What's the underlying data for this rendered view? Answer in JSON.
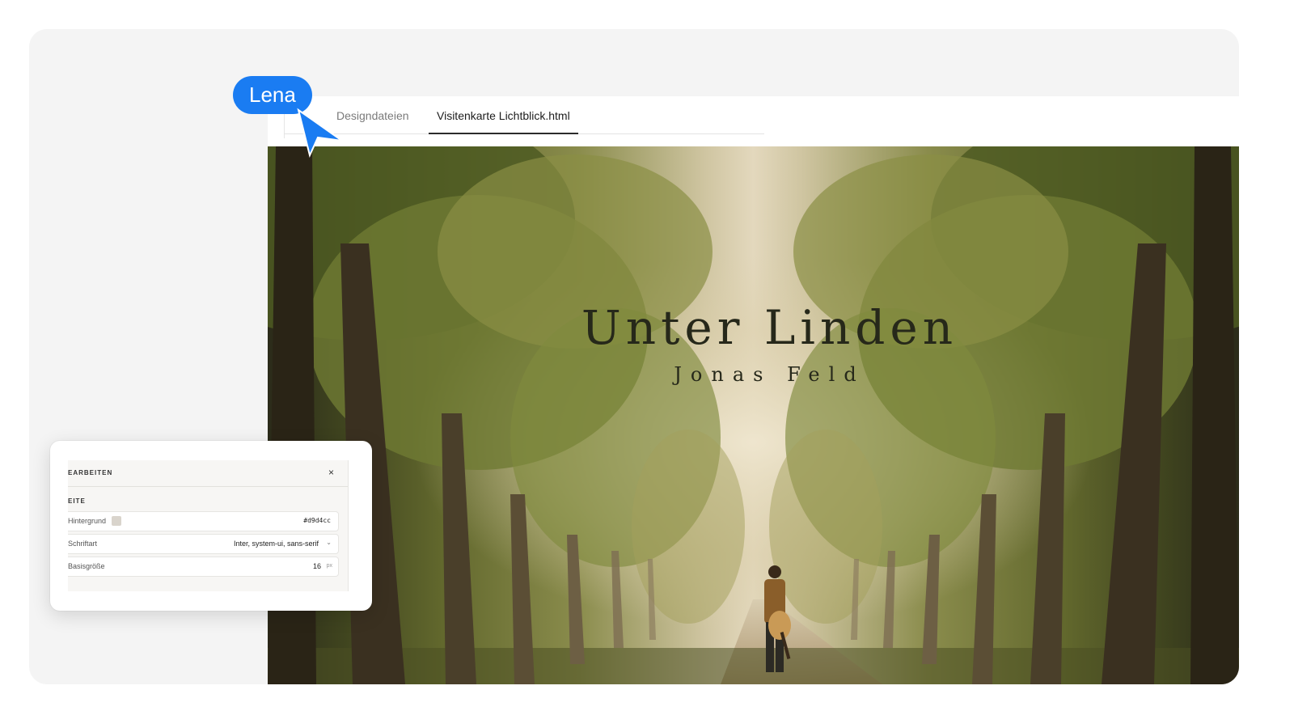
{
  "tabs": [
    {
      "label": "Designdateien",
      "active": false
    },
    {
      "label": "Visitenkarte Lichtblick.html",
      "active": true
    }
  ],
  "cover": {
    "title": "Unter Linden",
    "subtitle": "Jonas Feld"
  },
  "collaborator": {
    "name": "Lena",
    "color": "#1a7cf2"
  },
  "edit_panel": {
    "title": "EARBEITEN",
    "close_label": "×",
    "section_label": "EITE",
    "background": {
      "label": "Hintergrund",
      "value": "#d9d4cc"
    },
    "font": {
      "label": "Schriftart",
      "value": "Inter, system-ui, sans-serif"
    },
    "base_size": {
      "label": "Basisgröße",
      "value": "16",
      "unit": "px"
    }
  }
}
